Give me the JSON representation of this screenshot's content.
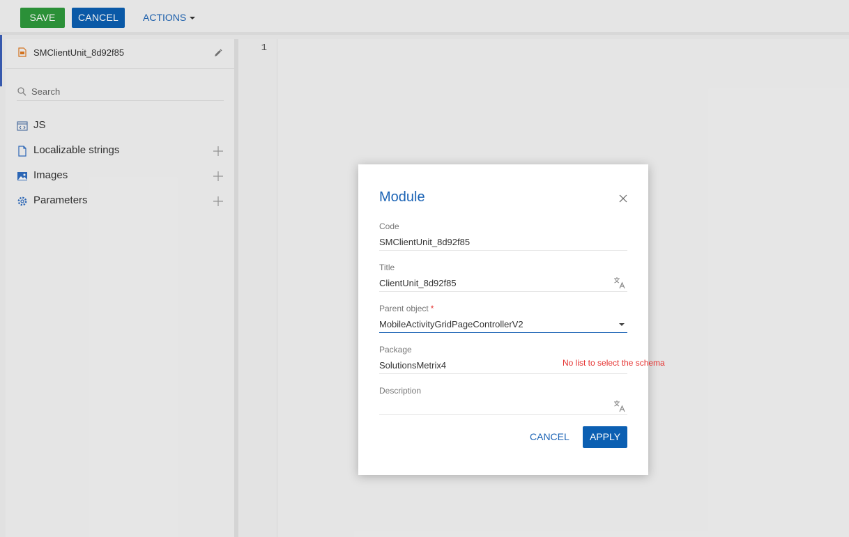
{
  "toolbar": {
    "save_label": "SAVE",
    "cancel_label": "CANCEL",
    "actions_label": "ACTIONS"
  },
  "sidebar": {
    "schema_name": "SMClientUnit_8d92f85",
    "search_placeholder": "Search",
    "items": [
      {
        "label": "JS",
        "icon": "js-icon",
        "addable": false
      },
      {
        "label": "Localizable strings",
        "icon": "document-icon",
        "addable": true
      },
      {
        "label": "Images",
        "icon": "image-icon",
        "addable": true
      },
      {
        "label": "Parameters",
        "icon": "gear-icon",
        "addable": true
      }
    ]
  },
  "editor": {
    "line_numbers": [
      "1"
    ]
  },
  "modal": {
    "title": "Module",
    "fields": {
      "code": {
        "label": "Code",
        "value": "SMClientUnit_8d92f85"
      },
      "title": {
        "label": "Title",
        "value": "ClientUnit_8d92f85"
      },
      "parent_object": {
        "label": "Parent object",
        "required_mark": "*",
        "value": "MobileActivityGridPageControllerV2"
      },
      "package": {
        "label": "Package",
        "value": "SolutionsMetrix4"
      },
      "description": {
        "label": "Description",
        "value": ""
      }
    },
    "error_message": "No list to select the schema",
    "cancel_label": "CANCEL",
    "apply_label": "APPLY"
  },
  "colors": {
    "save_green": "#2e9a3c",
    "primary_blue": "#0b5fb2",
    "link_blue": "#1b63b5",
    "error_red": "#e5312f"
  }
}
